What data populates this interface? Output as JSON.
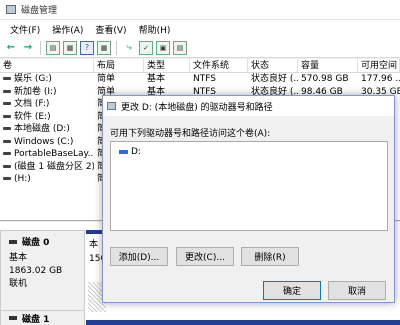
{
  "window": {
    "title": "磁盘管理"
  },
  "menu": [
    "文件(F)",
    "操作(A)",
    "查看(V)",
    "帮助(H)"
  ],
  "toolbar": {
    "icons": [
      "back-arrow",
      "forward-arrow",
      "properties",
      "help",
      "grid",
      "check",
      "disk",
      "settings"
    ]
  },
  "volume_table": {
    "columns": [
      "卷",
      "布局",
      "类型",
      "文件系统",
      "状态",
      "容量",
      "可用空间"
    ],
    "rows": [
      [
        "娱乐 (G:)",
        "简单",
        "基本",
        "NTFS",
        "状态良好 (...",
        "570.98 GB",
        "177.96 ..."
      ],
      [
        "新加卷 (I:)",
        "简单",
        "基本",
        "NTFS",
        "状态良好 (...",
        "98.46 GB",
        "30.35 GB"
      ],
      [
        "文档 (F:)",
        "简",
        "",
        "",
        "",
        "",
        ""
      ],
      [
        "软件 (E:)",
        "简",
        "",
        "",
        "",
        "",
        ""
      ],
      [
        "本地磁盘 (D:)",
        "简",
        "",
        "",
        "",
        "",
        ""
      ],
      [
        "Windows (C:)",
        "简",
        "",
        "",
        "",
        "",
        ""
      ],
      [
        "PortableBaseLay...",
        "简",
        "",
        "",
        "",
        "",
        ""
      ],
      [
        "(磁盘 1 磁盘分区 2)",
        "简",
        "",
        "",
        "",
        "",
        ""
      ],
      [
        "(H:)",
        "简",
        "",
        "",
        "",
        "",
        ""
      ]
    ]
  },
  "disk0": {
    "name": "磁盘 0",
    "type": "基本",
    "size": "1863.02 GB",
    "status": "联机",
    "partition_name": "本",
    "partition_size": "150"
  },
  "disk1": {
    "name": "磁盘 1"
  },
  "dialog": {
    "title": "更改 D: (本地磁盘) 的驱动器号和路径",
    "label": "可用下列驱动器号和路径访问这个卷(A):",
    "items": [
      "D:"
    ],
    "buttons": {
      "add": "添加(D)...",
      "change": "更改(C)...",
      "remove": "删除(R)",
      "ok": "确定",
      "cancel": "取消"
    }
  }
}
